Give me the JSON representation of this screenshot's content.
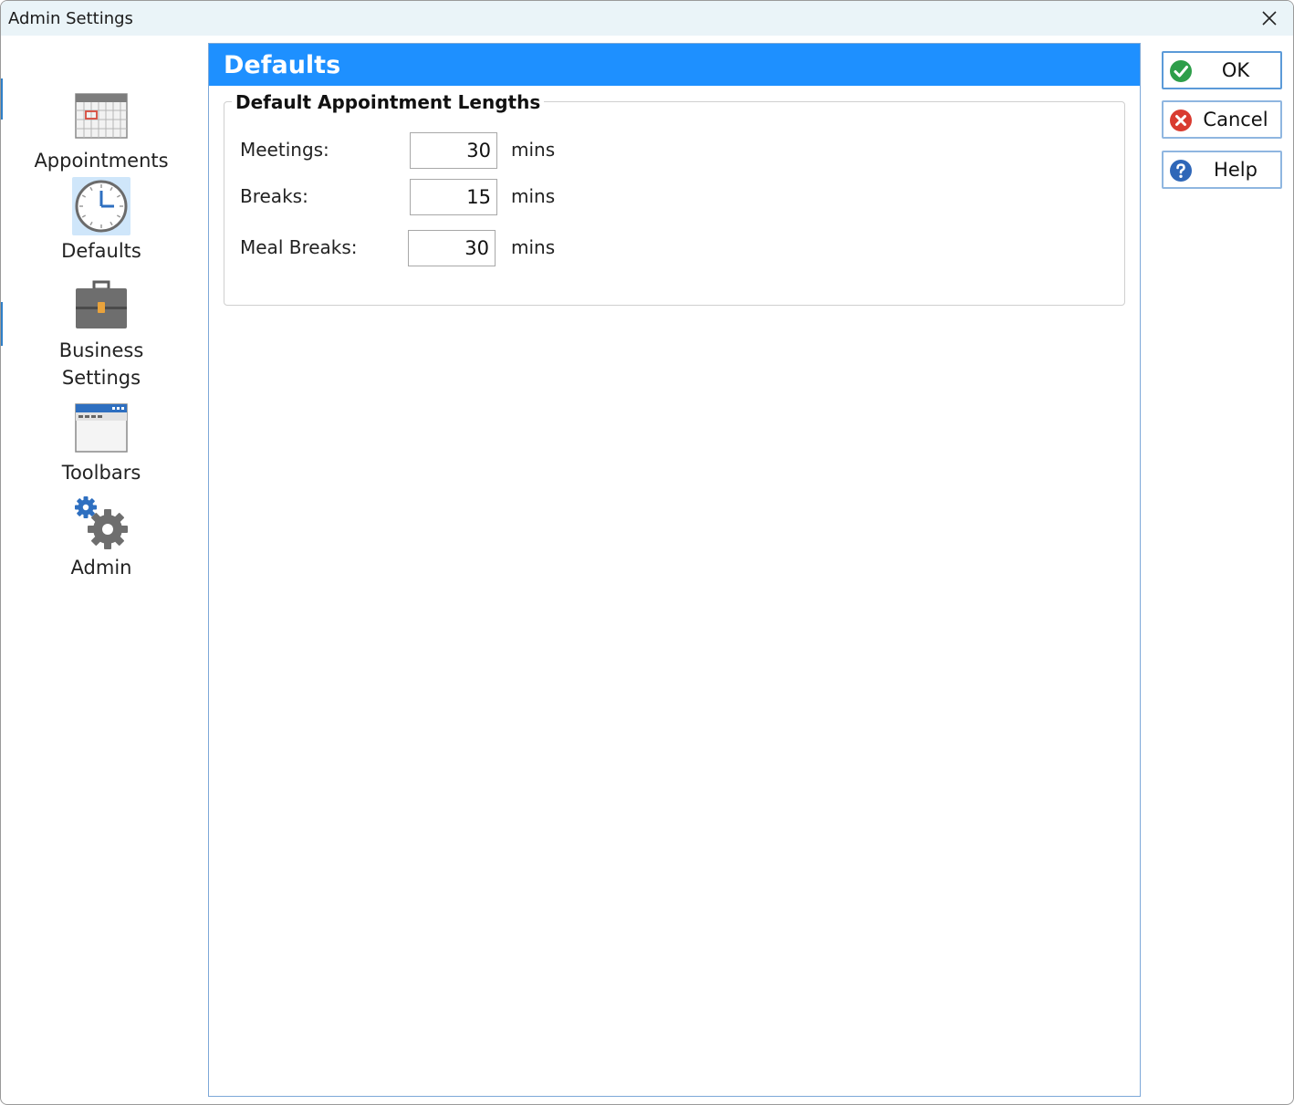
{
  "window": {
    "title": "Admin Settings"
  },
  "nav": {
    "items": [
      {
        "label": "Appointments",
        "icon": "calendar-icon"
      },
      {
        "label": "Defaults",
        "icon": "clock-icon",
        "selected": true
      },
      {
        "label_line1": "Business",
        "label_line2": "Settings",
        "icon": "briefcase-icon"
      },
      {
        "label": "Toolbars",
        "icon": "toolbar-window-icon"
      },
      {
        "label": "Admin",
        "icon": "gears-icon"
      }
    ]
  },
  "panel": {
    "title": "Defaults",
    "group": {
      "title": "Default Appointment Lengths",
      "rows": [
        {
          "label": "Meetings:",
          "value": "30",
          "unit": "mins"
        },
        {
          "label": "Breaks:",
          "value": "15",
          "unit": "mins"
        },
        {
          "label": "Meal Breaks:",
          "value": "30",
          "unit": "mins"
        }
      ]
    }
  },
  "buttons": {
    "ok": "OK",
    "cancel": "Cancel",
    "help": "Help"
  },
  "colors": {
    "header_blue": "#1e90ff",
    "selected_nav_bg": "#cfe6fa",
    "ok_green": "#2e9e4a",
    "cancel_red": "#d93b30",
    "help_blue": "#2f67b8"
  }
}
